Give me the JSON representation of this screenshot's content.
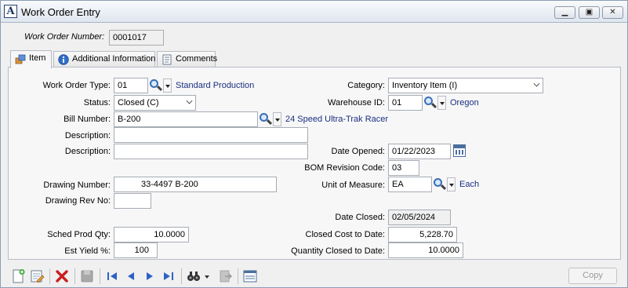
{
  "window": {
    "logo_letter": "A",
    "title": "Work Order Entry",
    "controls": [
      "minimize-icon",
      "restore-icon",
      "close-icon"
    ]
  },
  "header": {
    "wo_number_label": "Work Order Number:",
    "wo_number": "0001017"
  },
  "tabs": [
    {
      "label": "Item",
      "icon": "item-icon",
      "active": true
    },
    {
      "label": "Additional Information",
      "icon": "info-icon",
      "active": false
    },
    {
      "label": "Comments",
      "icon": "comments-icon",
      "active": false
    }
  ],
  "form": {
    "wo_type_label": "Work Order Type:",
    "wo_type": "01",
    "wo_type_desc": "Standard Production",
    "status_label": "Status:",
    "status": "Closed (C)",
    "bill_label": "Bill Number:",
    "bill": "B-200",
    "bill_desc": "24 Speed Ultra-Trak Racer",
    "desc1_label": "Description:",
    "desc1": "",
    "desc2_label": "Description:",
    "desc2": "",
    "drawing_label": "Drawing Number:",
    "drawing": "33-4497 B-200",
    "drawing_rev_label": "Drawing Rev No:",
    "drawing_rev": "",
    "sched_qty_label": "Sched Prod Qty:",
    "sched_qty": "10.0000",
    "yield_label": "Est Yield %:",
    "yield": "100",
    "category_label": "Category:",
    "category": "Inventory Item (I)",
    "warehouse_label": "Warehouse ID:",
    "warehouse": "01",
    "warehouse_desc": "Oregon",
    "date_opened_label": "Date Opened:",
    "date_opened": "01/22/2023",
    "bom_rev_label": "BOM Revision Code:",
    "bom_rev": "03",
    "uom_label": "Unit of Measure:",
    "uom": "EA",
    "uom_desc": "Each",
    "date_closed_label": "Date Closed:",
    "date_closed": "02/05/2024",
    "closed_cost_label": "Closed Cost to Date:",
    "closed_cost": "5,228.70",
    "qty_closed_label": "Quantity Closed to Date:",
    "qty_closed": "10.0000"
  },
  "toolbar": {
    "icons": [
      "new-icon",
      "edit-icon",
      "delete-icon",
      "save-icon",
      "first-record-icon",
      "previous-record-icon",
      "next-record-icon",
      "last-record-icon",
      "find-icon",
      "export-icon",
      "layout-icon"
    ],
    "copy_label": "Copy"
  },
  "colors": {
    "link_text": "#1a2f80",
    "delete": "#cc1f1f",
    "nav_arrows": "#2d62c4"
  }
}
